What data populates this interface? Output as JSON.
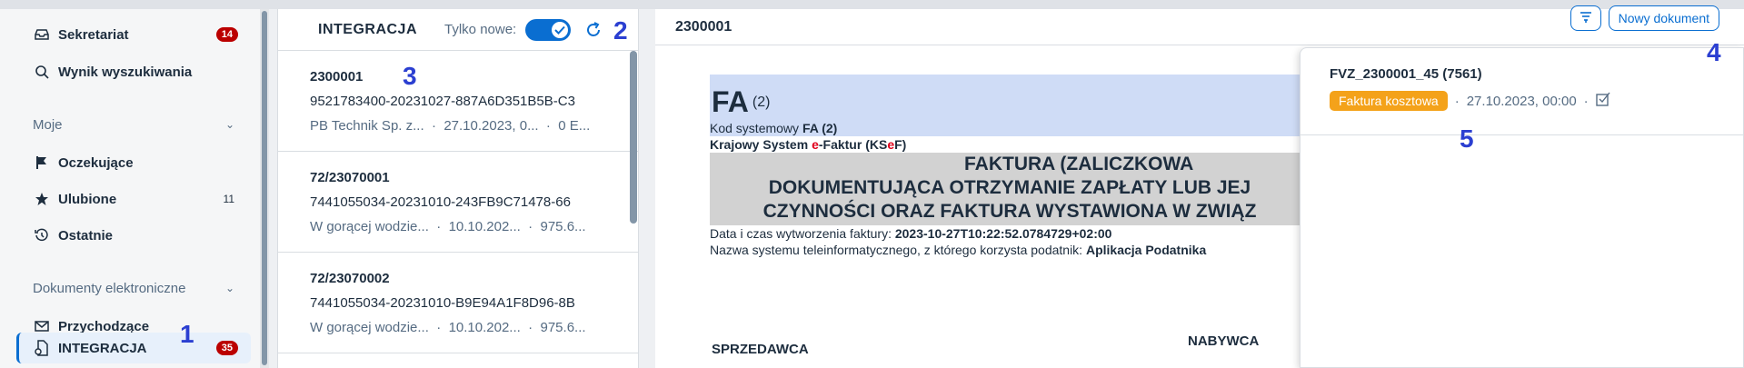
{
  "sidebar": {
    "items": [
      {
        "label": "Sekretariat",
        "icon": "inbox-tray-icon",
        "badge": "14"
      },
      {
        "label": "Wynik wyszukiwania",
        "icon": "search-icon"
      },
      {
        "label": "Oczekujące",
        "icon": "flag-icon"
      },
      {
        "label": "Ulubione",
        "icon": "star-icon",
        "count": "11"
      },
      {
        "label": "Ostatnie",
        "icon": "history-icon"
      },
      {
        "label": "Przychodzące",
        "icon": "envelope-icon"
      },
      {
        "label": "INTEGRACJA",
        "icon": "integration-icon",
        "badge": "35"
      }
    ],
    "sections": [
      "Moje",
      "Dokumenty elektroniczne"
    ]
  },
  "list": {
    "title": "INTEGRACJA",
    "filter_label": "Tylko nowe:",
    "items": [
      {
        "title": "2300001",
        "id": "9521783400-20231027-887A6D351B5B-C3",
        "company": "PB Technik Sp. z...",
        "date": "27.10.2023, 0...",
        "amount": "0 E..."
      },
      {
        "title": "72/23070001",
        "id": "7441055034-20231010-243FB9C71478-66",
        "company": "W gorącej wodzie...",
        "date": "10.10.202...",
        "amount": "975.6..."
      },
      {
        "title": "72/23070002",
        "id": "7441055034-20231010-B9E94A1F8D96-8B",
        "company": "W gorącej wodzie...",
        "date": "10.10.202...",
        "amount": "975.6..."
      }
    ],
    "meta_sep": "·"
  },
  "detail": {
    "title": "2300001",
    "new_doc_label": "Nowy dokument",
    "doc": {
      "fa": "FA",
      "fa_variant": "(2)",
      "system_code_label": "Kod systemowy",
      "system_code_value": "FA (2)",
      "ksef_prefix": "Krajowy System ",
      "ksef_e": "e",
      "ksef_mid": "-Faktur (KS",
      "ksef_e2": "e",
      "ksef_suffix": "F)",
      "heading_1": "FAKTURA (ZALICZKOWA",
      "heading_2": "DOKUMENTUJĄCA OTRZYMANIE ZAPŁATY LUB JEJ",
      "heading_3": "CZYNNOŚCI ORAZ FAKTURA WYSTAWIONA W ZWIĄZ",
      "created_label": "Data i czas wytworzenia faktury: ",
      "created_value": "2023-10-27T10:22:52.0784729+02:00",
      "system_name_label": "Nazwa systemu teleinformatycznego, z którego korzysta podatnik: ",
      "system_name_value": "Aplikacja Podatnika",
      "seller": "SPRZEDAWCA",
      "buyer": "NABYWCA"
    }
  },
  "popover": {
    "title": "FVZ_2300001_45 (7561)",
    "tag": "Faktura kosztowa",
    "date": "27.10.2023, 00:00",
    "sep": "·"
  },
  "annotations": [
    "1",
    "2",
    "3",
    "4",
    "5"
  ],
  "colors": {
    "accent": "#0a6ed1",
    "badge": "#bb0000",
    "tag": "#f4a21a",
    "annotation": "#2b3fd1"
  }
}
